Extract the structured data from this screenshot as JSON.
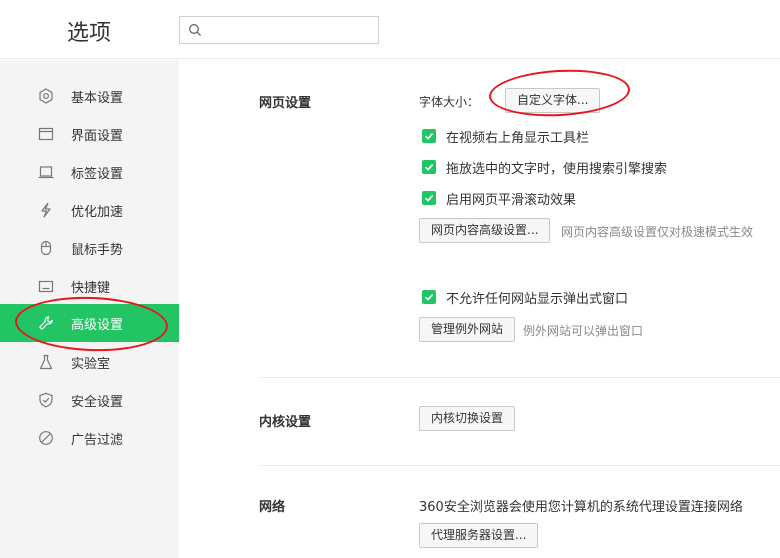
{
  "app": {
    "title": "选项"
  },
  "search": {
    "placeholder": "",
    "value": ""
  },
  "sidebar": {
    "items": [
      {
        "label": "基本设置",
        "icon": "gear-icon"
      },
      {
        "label": "界面设置",
        "icon": "window-icon"
      },
      {
        "label": "标签设置",
        "icon": "tab-icon"
      },
      {
        "label": "优化加速",
        "icon": "lightning-icon"
      },
      {
        "label": "鼠标手势",
        "icon": "mouse-icon"
      },
      {
        "label": "快捷键",
        "icon": "keyboard-icon"
      },
      {
        "label": "高级设置",
        "icon": "wrench-icon",
        "active": true
      },
      {
        "label": "实验室",
        "icon": "flask-icon"
      },
      {
        "label": "安全设置",
        "icon": "shield-icon"
      },
      {
        "label": "广告过滤",
        "icon": "block-icon"
      }
    ]
  },
  "webpage": {
    "title": "网页设置",
    "font_size_label": "字体大小：",
    "custom_font_button": "自定义字体...",
    "checkboxes": [
      {
        "label": "在视频右上角显示工具栏",
        "checked": true
      },
      {
        "label": "拖放选中的文字时，使用搜索引擎搜索",
        "checked": true
      },
      {
        "label": "启用网页平滑滚动效果",
        "checked": true
      }
    ],
    "advanced_button": "网页内容高级设置...",
    "advanced_hint": "网页内容高级设置仅对极速模式生效",
    "popup_checkbox": {
      "label": "不允许任何网站显示弹出式窗口",
      "checked": true
    },
    "manage_exceptions_button": "管理例外网站",
    "exceptions_hint": "例外网站可以弹出窗口"
  },
  "kernel": {
    "title": "内核设置",
    "switch_button": "内核切换设置"
  },
  "network": {
    "title": "网络",
    "description": "360安全浏览器会使用您计算机的系统代理设置连接网络",
    "proxy_button": "代理服务器设置..."
  },
  "colors": {
    "accent": "#23c464",
    "annotation": "#e8151b",
    "sidebar_bg": "#f4f4f4"
  }
}
